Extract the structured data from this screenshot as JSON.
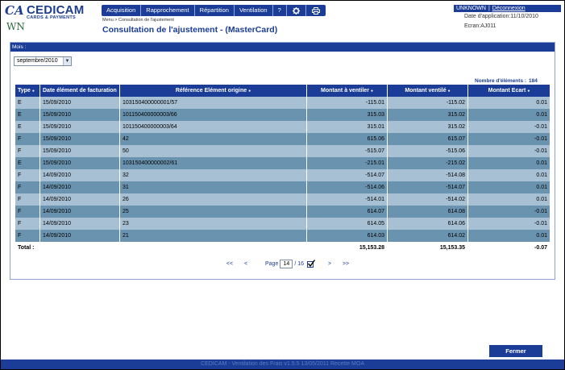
{
  "logo": {
    "mark": "CA",
    "name": "CEDICAM",
    "tagline": "CARDS & PAYMENTS",
    "env": "WN"
  },
  "nav": [
    {
      "label": "Acquisition"
    },
    {
      "label": "Rapprochement"
    },
    {
      "label": "Répartition"
    },
    {
      "label": "Ventilation"
    },
    {
      "label": "?"
    }
  ],
  "nav_icons": [
    "gear-icon",
    "printer-icon"
  ],
  "breadcrumb": "Menu > Consultation de l'ajustement",
  "title": "Consultation de l'ajustement - (MasterCard)",
  "user": {
    "name": "UNKNOWN",
    "logout": "Déconnexion"
  },
  "app_date": "Date d'application:11/10/2010",
  "screen": "Ecran:AJ011",
  "filter": {
    "label": "Mois :",
    "value": "septembre/2010"
  },
  "count": {
    "label": "Nombre d'éléments :",
    "value": "184"
  },
  "table": {
    "headers": [
      "Type",
      "Date élément de facturation",
      "Référence Elément origine",
      "Montant à ventiler",
      "Montant ventilé",
      "Montant Ecart"
    ],
    "rows": [
      [
        "E",
        "15/09/2010",
        "103150400000001/57",
        "-115.01",
        "-115.02",
        "0.01"
      ],
      [
        "E",
        "15/09/2010",
        "101150400000003/66",
        "315.03",
        "315.02",
        "0.01"
      ],
      [
        "E",
        "15/09/2010",
        "101150400000003/64",
        "315.01",
        "315.02",
        "-0.01"
      ],
      [
        "F",
        "15/09/2010",
        "42",
        "615.06",
        "615.07",
        "-0.01"
      ],
      [
        "F",
        "15/09/2010",
        "50",
        "-515.07",
        "-515.06",
        "-0.01"
      ],
      [
        "E",
        "15/09/2010",
        "103150400000002/61",
        "-215.01",
        "-215.02",
        "0.01"
      ],
      [
        "F",
        "14/09/2010",
        "32",
        "-514.07",
        "-514.08",
        "0.01"
      ],
      [
        "F",
        "14/09/2010",
        "31",
        "-514.06",
        "-514.07",
        "0.01"
      ],
      [
        "F",
        "14/09/2010",
        "26",
        "-514.01",
        "-514.02",
        "0.01"
      ],
      [
        "F",
        "14/09/2010",
        "25",
        "614.07",
        "614.08",
        "-0.01"
      ],
      [
        "F",
        "14/09/2010",
        "23",
        "614.05",
        "614.06",
        "-0.01"
      ],
      [
        "F",
        "14/09/2010",
        "21",
        "614.03",
        "614.02",
        "0.01"
      ]
    ],
    "total": {
      "label": "Total :",
      "a_ventiler": "15,153.28",
      "ventile": "15,153.35",
      "ecart": "-0.07"
    }
  },
  "pager": {
    "first": "<<",
    "prev": "<",
    "page_label": "Page",
    "page": "14",
    "of": "/ 16",
    "next": ">",
    "last": ">>"
  },
  "close_button": "Fermer",
  "footer": "CEDICAM - Ventilation des Frais v1.5.5 13/05/2011 Recette MOA"
}
